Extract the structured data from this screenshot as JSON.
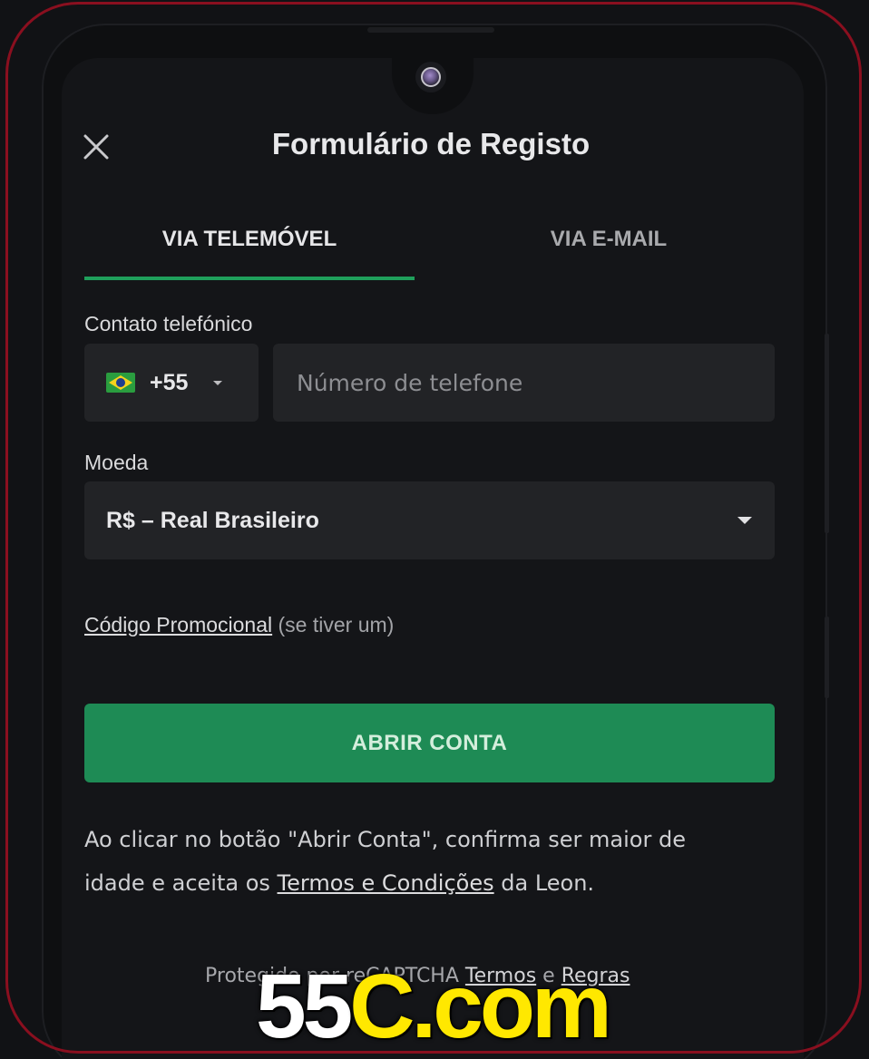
{
  "colors": {
    "accent": "#1f9f5b",
    "button": "#1e8b55",
    "frame": "#8a0f1f",
    "field_bg": "#222326",
    "screen_bg": "#141518",
    "watermark_white": "#ffffff",
    "watermark_yellow": "#ffe800"
  },
  "header": {
    "title": "Formulário de Registo",
    "close_icon": "close-icon"
  },
  "tabs": [
    {
      "label": "VIA TELEMÓVEL",
      "active": true
    },
    {
      "label": "VIA E-MAIL",
      "active": false
    }
  ],
  "phone": {
    "label": "Contato telefónico",
    "country_flag": "brazil-flag-icon",
    "dial_code": "+55",
    "placeholder": "Número de telefone",
    "value": ""
  },
  "currency": {
    "label": "Moeda",
    "selected": "R$ – Real Brasileiro"
  },
  "promo": {
    "link": "Código Promocional",
    "hint": "(se tiver um)"
  },
  "submit": {
    "label": "ABRIR CONTA"
  },
  "disclaimer": {
    "line1": "Ao clicar no botão \"Abrir Conta\", confirma ser maior de",
    "pre_link": "idade e aceita os ",
    "link": "Termos e Condições",
    "post_link": " da Leon."
  },
  "recaptcha": {
    "prefix": "Protegido por reCAPTCHA",
    "terms": "Termos",
    "and": "e",
    "rules": "Regras"
  },
  "watermark": {
    "part1": "55",
    "part2": "C.com"
  }
}
